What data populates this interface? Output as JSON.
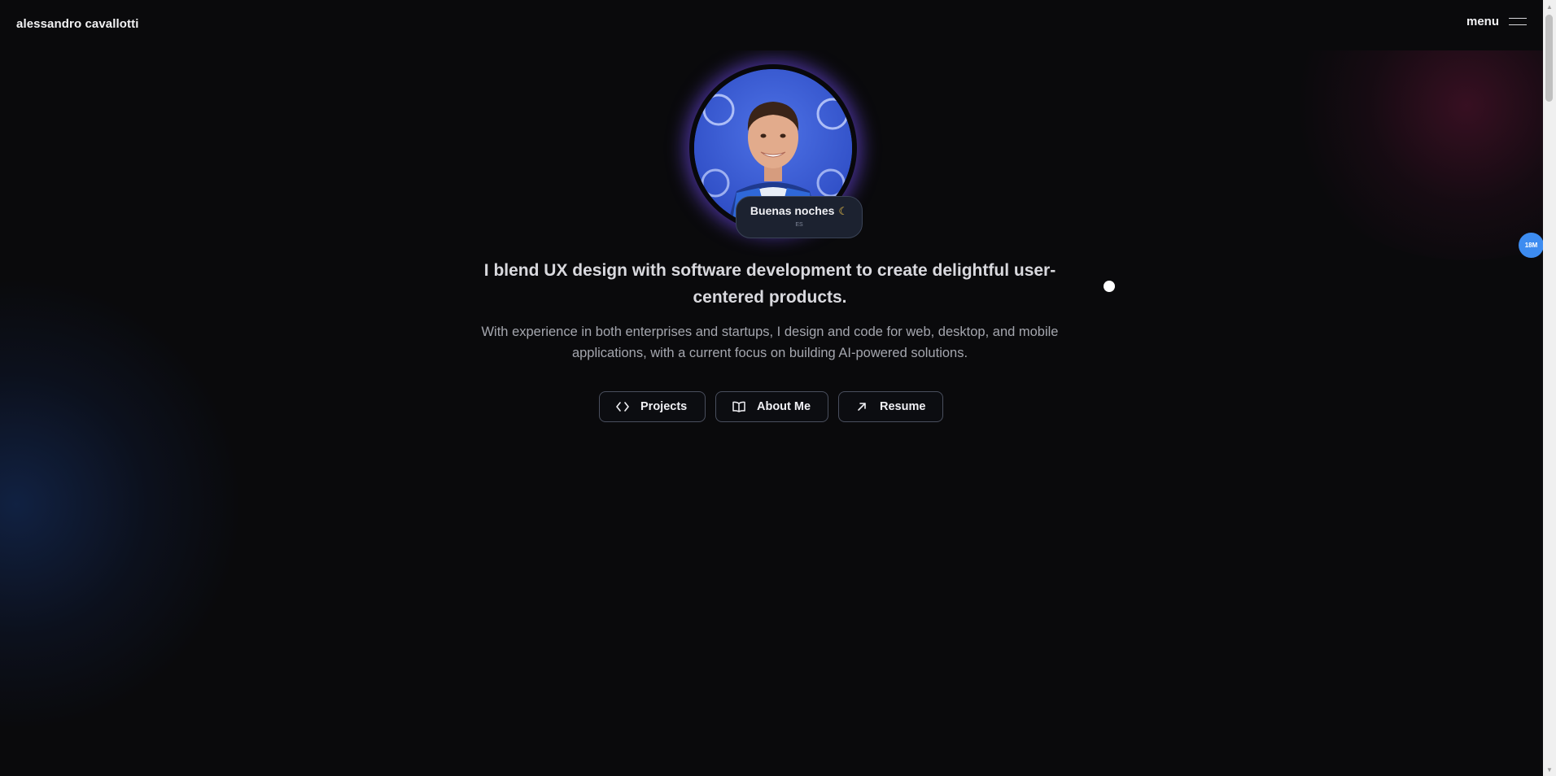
{
  "header": {
    "brand": "alessandro cavallotti",
    "menu_label": "menu"
  },
  "hero": {
    "greeting": "Buenas noches",
    "greeting_icon": "moon-icon",
    "greeting_sub": "ES",
    "headline": "I blend UX design with software development to create delightful user-centered products.",
    "subtext": "With experience in both enterprises and startups, I design and code for web, desktop, and mobile applications, with a current focus on building AI-powered solutions."
  },
  "buttons": [
    {
      "label": "Projects",
      "icon": "code-icon"
    },
    {
      "label": "About Me",
      "icon": "book-icon"
    },
    {
      "label": "Resume",
      "icon": "arrow-up-right-icon"
    }
  ],
  "side_badge": "18M",
  "colors": {
    "background": "#0a0a0c",
    "accent_glow": "#7850ff",
    "badge": "#3d8cf0"
  }
}
